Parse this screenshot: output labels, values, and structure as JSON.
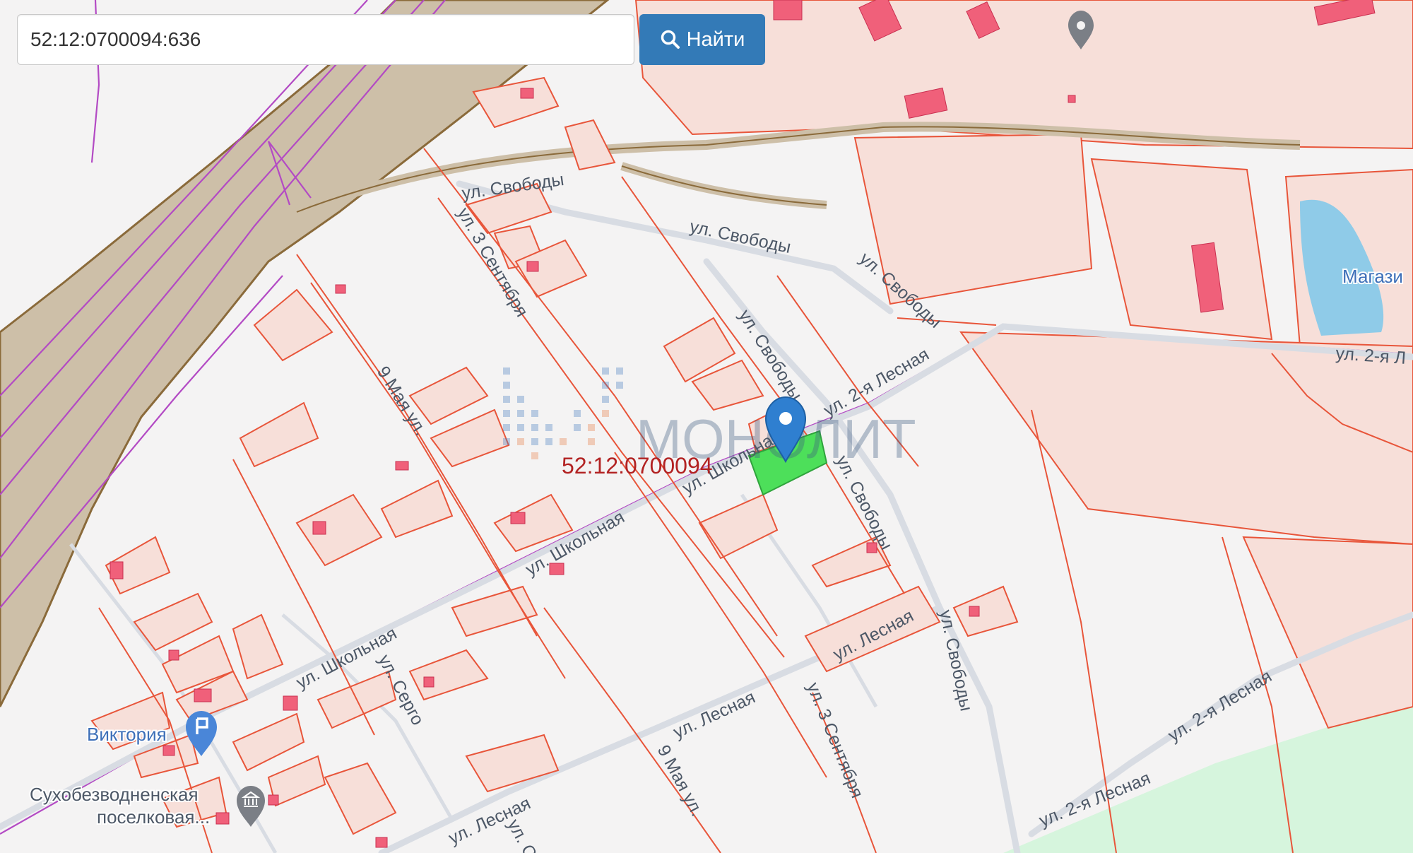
{
  "search": {
    "value": "52:12:0700094:636",
    "button_label": "Найти"
  },
  "parcel": {
    "label": "52:12:0700094",
    "highlight_color": "#4ddf5a",
    "label_color": "#b22222"
  },
  "watermark": "МОНОЛИТ",
  "streets": {
    "svobody": "ул. Свободы",
    "sentyabrya": "ул. 3 Сентября",
    "maya_ul": "9 Мая ул.",
    "maya_ul_short": "9 Мая ул.",
    "lesnaya_2": "ул. 2-я Лесная",
    "lesnaya_2_edge": "ул. 2-я Л",
    "shkolnaya": "ул. Школьная",
    "shkolnaya_short": "ул. Школьна",
    "sergo": "ул. Серго",
    "lesnaya": "ул. Лесная",
    "lesnaya_short": "ул. С"
  },
  "pois": {
    "viktoriya": "Виктория",
    "library_line1": "Сухобезводненская",
    "library_line2": "поселковая...",
    "magazin": "Магази"
  },
  "colors": {
    "parcel_fill": "#f7dfd9",
    "parcel_border": "#e8553a",
    "building": "#f0607a",
    "railway_zone": "#cdbfa8",
    "rail_line": "#b34ac4",
    "road": "#d8dce3",
    "water": "#8fcbe8",
    "forest": "#d6f5dd",
    "button": "#337ab7"
  }
}
